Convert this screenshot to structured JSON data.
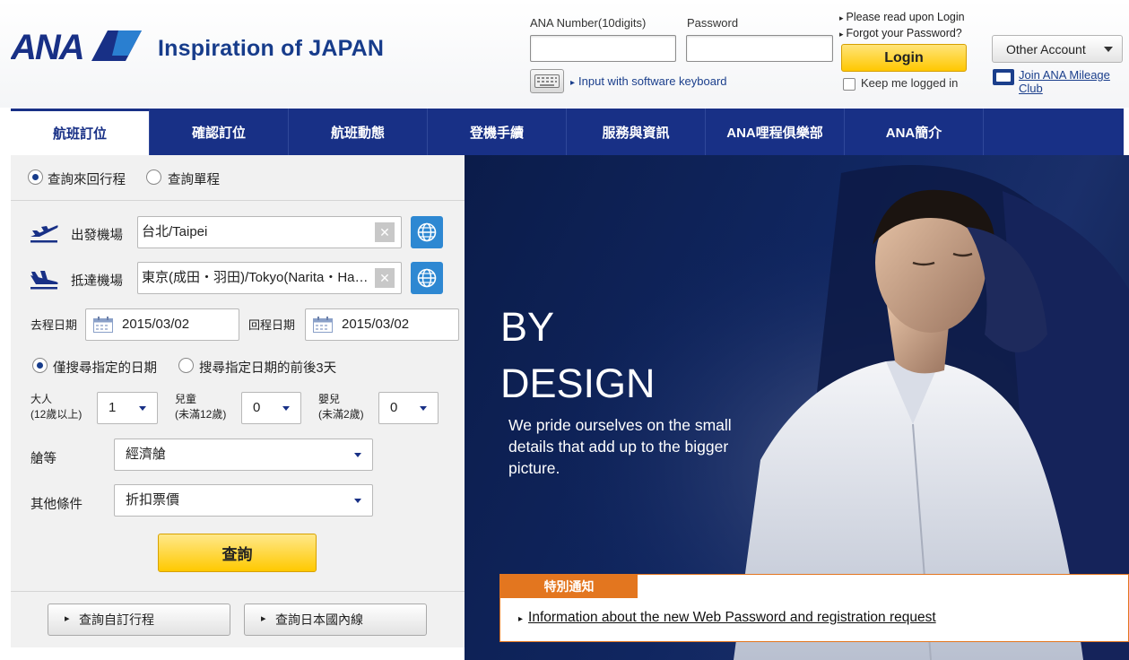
{
  "header": {
    "logo_text": "ANA",
    "tagline": "Inspiration of JAPAN",
    "ana_number_label": "ANA Number(10digits)",
    "ana_number_value": "",
    "password_label": "Password",
    "password_value": "",
    "software_keyboard_link": "Input with software keyboard",
    "read_upon_login_link": "Please read upon Login",
    "forgot_password_link": "Forgot your Password?",
    "login_button": "Login",
    "keep_logged_in": "Keep me logged in",
    "other_account_button": "Other Account",
    "join_mileage_link": "Join ANA Mileage Club"
  },
  "nav": {
    "items": [
      "航班訂位",
      "確認訂位",
      "航班動態",
      "登機手續",
      "服務與資訊",
      "ANA哩程俱樂部",
      "ANA簡介"
    ],
    "active_index": 0
  },
  "search": {
    "trip_types": [
      "查詢來回行程",
      "查詢單程"
    ],
    "trip_selected": 0,
    "departure_label": "出發機場",
    "departure_value": "台北/Taipei",
    "arrival_label": "抵達機場",
    "arrival_value": "東京(成田・羽田)/Tokyo(Narita・Haneda)",
    "outbound_label": "去程日期",
    "outbound_date": "2015/03/02",
    "return_label": "回程日期",
    "return_date": "2015/03/02",
    "date_modes": [
      "僅搜尋指定的日期",
      "搜尋指定日期的前後3天"
    ],
    "date_mode_selected": 0,
    "adult_label": "大人",
    "adult_note": "(12歲以上)",
    "adult_value": "1",
    "child_label": "兒童",
    "child_note": "(未滿12歲)",
    "child_value": "0",
    "infant_label": "嬰兒",
    "infant_note": "(未滿2歲)",
    "infant_value": "0",
    "class_label": "艙等",
    "class_value": "經濟艙",
    "other_label": "其他條件",
    "other_value": "折扣票價",
    "search_button": "查詢",
    "custom_itinerary_button": "查詢自訂行程",
    "japan_domestic_button": "查詢日本國內線"
  },
  "hero": {
    "title_line1": "BY",
    "title_line2": "DESIGN",
    "subtitle": "We pride ourselves on the small details that add up to the bigger picture."
  },
  "notice": {
    "tab": "特別通知",
    "link": "Information about the new Web Password and registration request"
  },
  "colors": {
    "brand_blue": "#183086",
    "accent_yellow": "#ffc800",
    "notice_orange": "#e3761f"
  }
}
